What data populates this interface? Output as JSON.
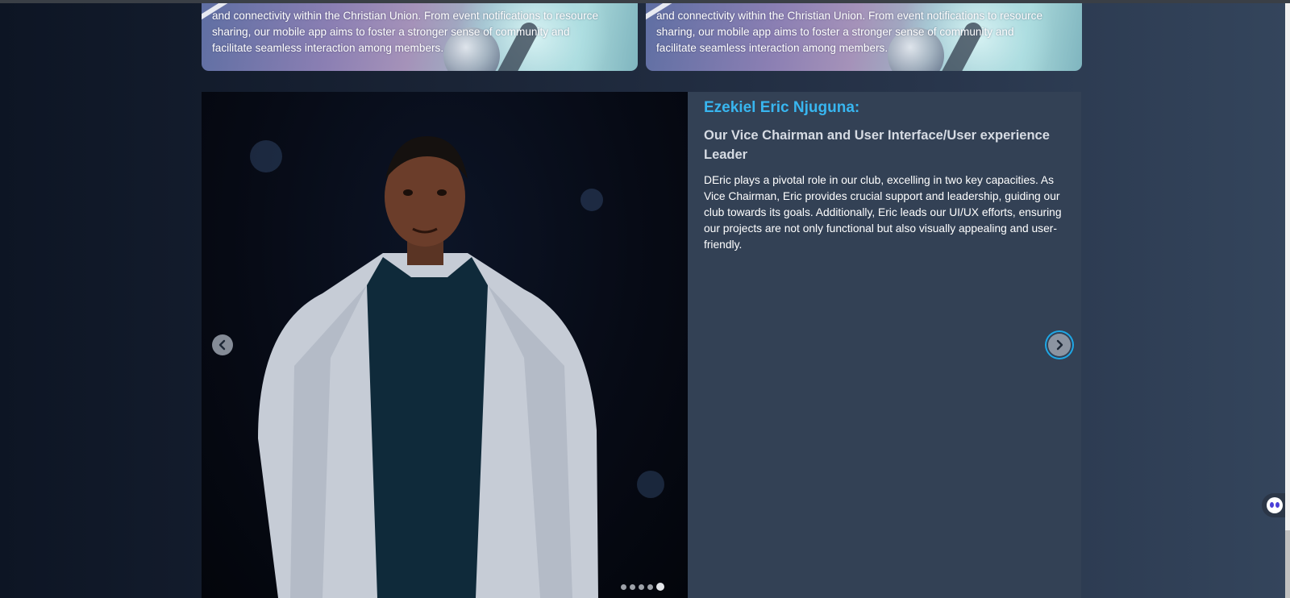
{
  "cards": [
    {
      "lines": [
        "and connectivity within the Christian Union. From event notifications to resource",
        "sharing, our mobile app aims to foster a stronger sense of community and",
        "facilitate seamless interaction among members."
      ]
    },
    {
      "lines": [
        "and connectivity within the Christian Union. From event notifications to resource",
        "sharing, our mobile app aims to foster a stronger sense of community and",
        "facilitate seamless interaction among members."
      ]
    }
  ],
  "profile": {
    "name": "Ezekiel Eric Njuguna:",
    "role": "Our Vice Chairman and User Interface/User experience Leader",
    "bio": "DEric plays a pivotal role in our club, excelling in two key capacities. As Vice Chairman, Eric provides crucial support and leadership, guiding our club towards its goals. Additionally, Eric leads our UI/UX efforts, ensuring our projects are not only functional but also visually appealing and user-friendly."
  },
  "carousel": {
    "slide_count": 5,
    "active_slide": 5,
    "prev_icon": "chevron-left-icon",
    "next_icon": "chevron-right-icon"
  },
  "colors": {
    "accent": "#38b6f0",
    "panel": "#334155",
    "focus_ring": "#1ea7e6"
  },
  "widget": {
    "icon": "chat-assistant-icon"
  }
}
